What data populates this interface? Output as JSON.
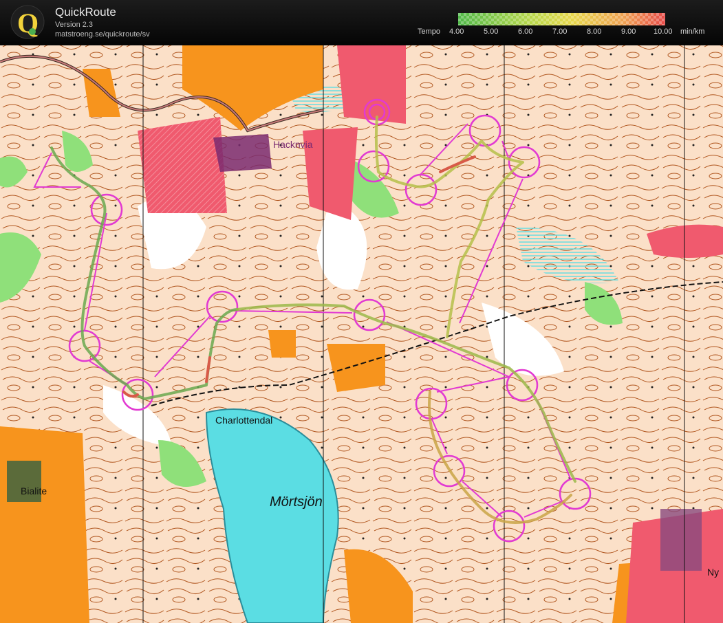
{
  "app": {
    "title": "QuickRoute",
    "version": "Version 2.3",
    "url": "matstroeng.se/quickroute/sv"
  },
  "legend": {
    "label": "Tempo",
    "ticks": [
      "4.00",
      "5.00",
      "6.00",
      "7.00",
      "8.00",
      "9.00",
      "10.00"
    ],
    "unit": "min/km",
    "colors": {
      "fast": "#3fb34f",
      "mid": "#e9e24a",
      "slow": "#e8443a"
    }
  },
  "map": {
    "place_names": {
      "hacknvia": "Hacknvia",
      "charlottendal": "Charlottendal",
      "mortsjon": "Mörtsjön",
      "bialite": "Bialite",
      "ny": "Ny"
    },
    "colors": {
      "open_land": "#fbe0c8",
      "forest_white": "#ffffff",
      "green": "#8fe07a",
      "orange_field": "#f7941d",
      "red_private": "#f05a6e",
      "lake": "#5bdde3",
      "contour": "#b0561f",
      "course": "#e23ad2",
      "magnetic_north": "#111111"
    }
  }
}
